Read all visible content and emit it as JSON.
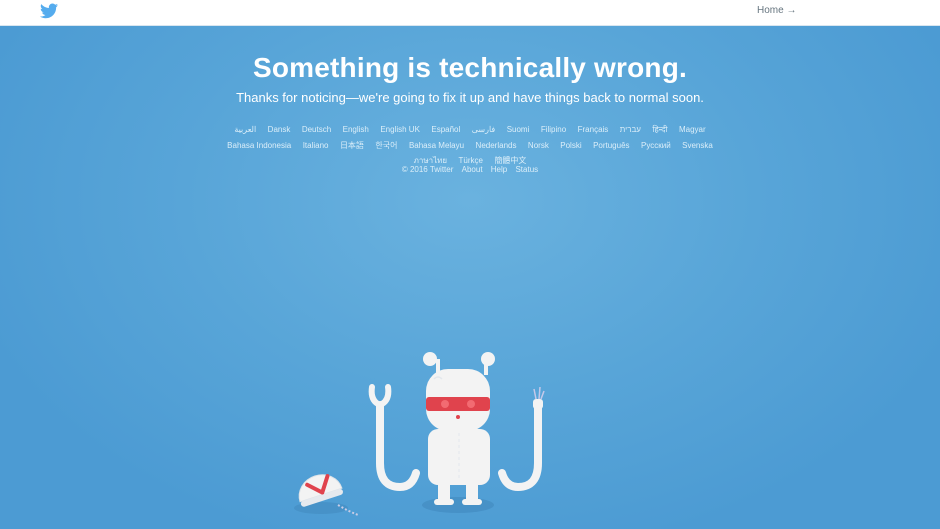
{
  "header": {
    "home_label": "Home →",
    "logo_icon": "twitter-bird-icon"
  },
  "error": {
    "title": "Something is technically wrong.",
    "subtitle": "Thanks for noticing—we're going to fix it up and have things back to normal soon."
  },
  "languages": [
    "العربية",
    "Dansk",
    "Deutsch",
    "English",
    "English UK",
    "Español",
    "فارسی",
    "Suomi",
    "Filipino",
    "Français",
    "עברית",
    "हिन्दी",
    "Magyar",
    "Bahasa Indonesia",
    "Italiano",
    "日本語",
    "한국어",
    "Bahasa Melayu",
    "Nederlands",
    "Norsk",
    "Polski",
    "Português",
    "Русский",
    "Svenska",
    "ภาษาไทย",
    "Türkçe",
    "簡體中文"
  ],
  "footer": {
    "copyright": "© 2016 Twitter",
    "about": "About",
    "help": "Help",
    "status": "Status"
  },
  "colors": {
    "background": "#58a5d8",
    "robot_band": "#e0434d"
  }
}
